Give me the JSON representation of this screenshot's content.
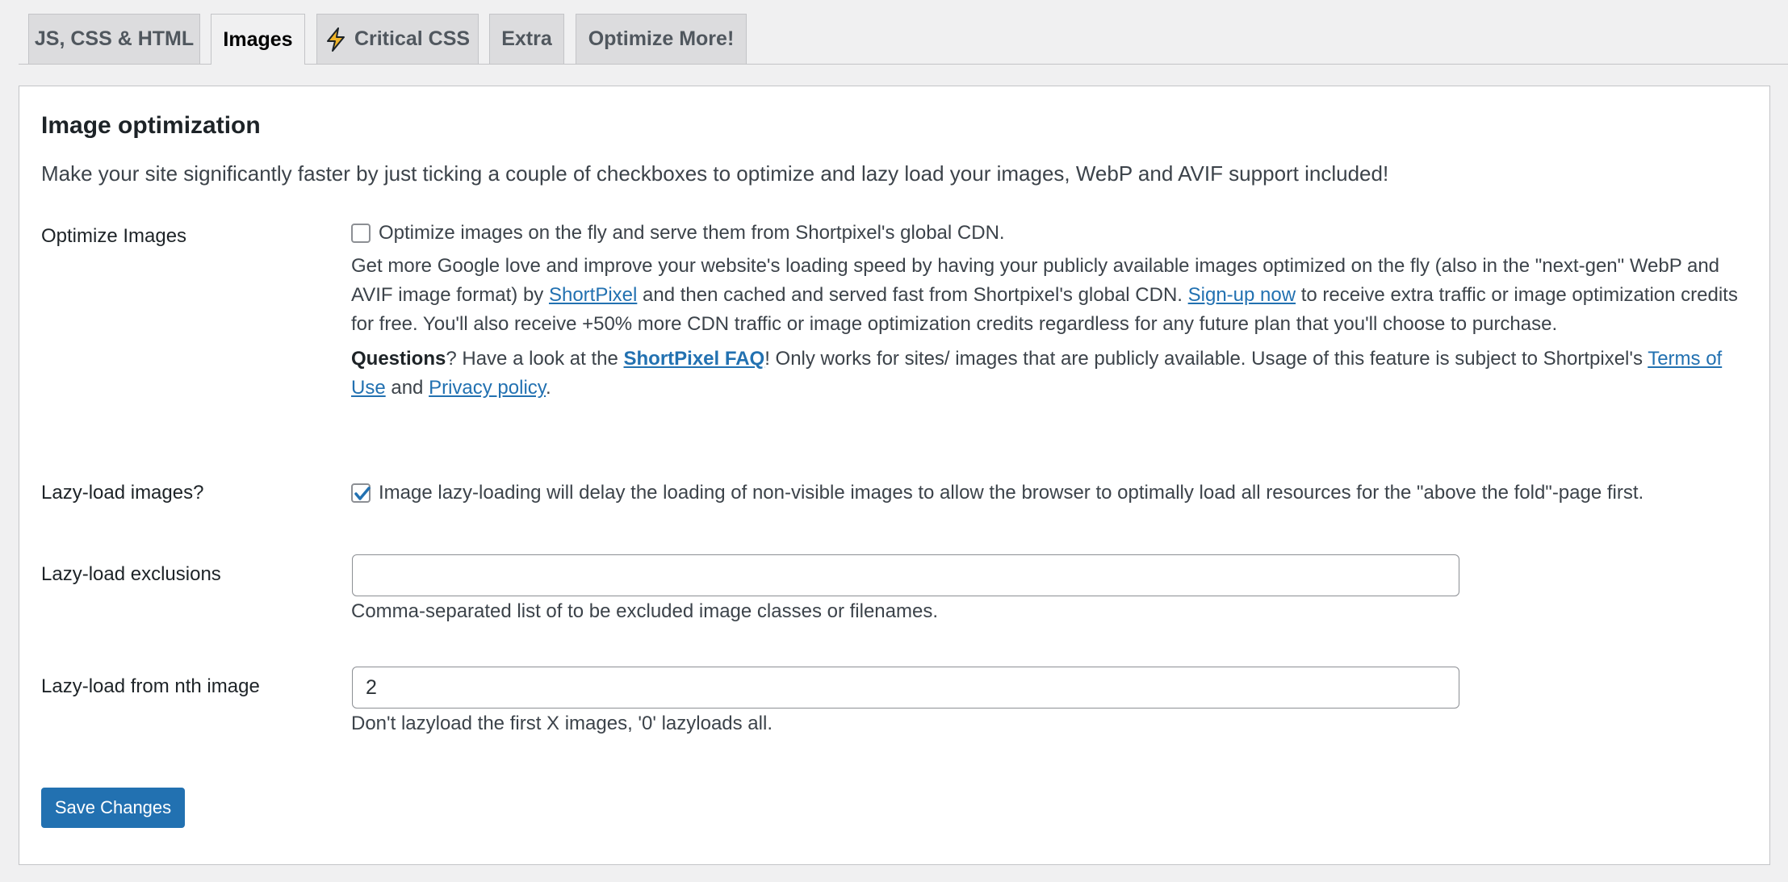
{
  "tabs": [
    {
      "label": "JS, CSS & HTML"
    },
    {
      "label": "Images"
    },
    {
      "label": "Critical CSS"
    },
    {
      "label": "Extra"
    },
    {
      "label": "Optimize More!"
    }
  ],
  "active_tab": "Images",
  "section": {
    "title": "Image optimization",
    "intro": "Make your site significantly faster by just ticking a couple of checkboxes to optimize and lazy load your images, WebP and AVIF support included!"
  },
  "optimize_images": {
    "label": "Optimize Images",
    "checked": false,
    "checkbox_text": "Optimize images on the fly and serve them from Shortpixel's global CDN.",
    "desc1_a": "Get more Google love and improve your website's loading speed by having your publicly available images optimized on the fly (also in the \"next-gen\" WebP and AVIF image format) by ",
    "desc1_link1": "ShortPixel",
    "desc1_b": " and then cached and served fast from Shortpixel's global CDN. ",
    "desc1_link2": "Sign-up now",
    "desc1_c": " to receive extra traffic or image optimization credits for free. You'll also receive +50% more CDN traffic or image optimization credits regardless for any future plan that you'll choose to purchase.",
    "desc2_bold": "Questions",
    "desc2_a": "? Have a look at the ",
    "desc2_link1": "ShortPixel FAQ",
    "desc2_b": "! Only works for sites/ images that are publicly available. Usage of this feature is subject to Shortpixel's ",
    "desc2_link2": "Terms of Use",
    "desc2_c": " and ",
    "desc2_link3": "Privacy policy",
    "desc2_d": "."
  },
  "lazy_load": {
    "label": "Lazy-load images?",
    "checked": true,
    "checkbox_text": "Image lazy-loading will delay the loading of non-visible images to allow the browser to optimally load all resources for the \"above the fold\"-page first."
  },
  "lazy_exclusions": {
    "label": "Lazy-load exclusions",
    "value": "",
    "description": "Comma-separated list of to be excluded image classes or filenames."
  },
  "lazy_nth": {
    "label": "Lazy-load from nth image",
    "value": "2",
    "description": "Don't lazyload the first X images, '0' lazyloads all."
  },
  "save_label": "Save Changes",
  "colors": {
    "accent": "#2271b1",
    "background": "#f0f0f1",
    "bolt": "#f0b429"
  },
  "icons": {
    "critical_css_tab": "lightning-bolt-icon",
    "checkmark": "checkmark-icon"
  }
}
